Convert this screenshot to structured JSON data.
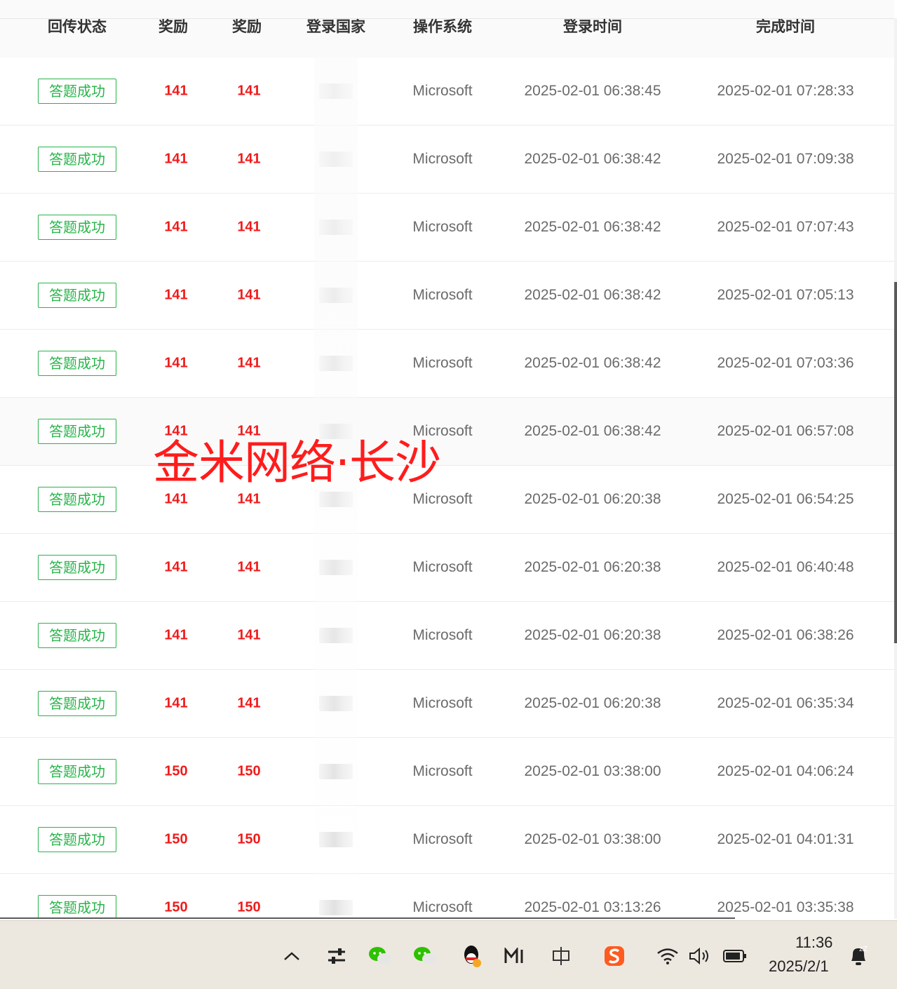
{
  "table": {
    "headers": [
      "回传状态",
      "奖励",
      "奖励",
      "登录国家",
      "操作系统",
      "登录时间",
      "完成时间"
    ],
    "rows": [
      {
        "status": "答题成功",
        "reward1": "141",
        "reward2": "141",
        "os": "Microsoft",
        "login": "2025-02-01 06:38:45",
        "done": "2025-02-01 07:28:33"
      },
      {
        "status": "答题成功",
        "reward1": "141",
        "reward2": "141",
        "os": "Microsoft",
        "login": "2025-02-01 06:38:42",
        "done": "2025-02-01 07:09:38"
      },
      {
        "status": "答题成功",
        "reward1": "141",
        "reward2": "141",
        "os": "Microsoft",
        "login": "2025-02-01 06:38:42",
        "done": "2025-02-01 07:07:43"
      },
      {
        "status": "答题成功",
        "reward1": "141",
        "reward2": "141",
        "os": "Microsoft",
        "login": "2025-02-01 06:38:42",
        "done": "2025-02-01 07:05:13"
      },
      {
        "status": "答题成功",
        "reward1": "141",
        "reward2": "141",
        "os": "Microsoft",
        "login": "2025-02-01 06:38:42",
        "done": "2025-02-01 07:03:36"
      },
      {
        "status": "答题成功",
        "reward1": "141",
        "reward2": "141",
        "os": "Microsoft",
        "login": "2025-02-01 06:38:42",
        "done": "2025-02-01 06:57:08"
      },
      {
        "status": "答题成功",
        "reward1": "141",
        "reward2": "141",
        "os": "Microsoft",
        "login": "2025-02-01 06:20:38",
        "done": "2025-02-01 06:54:25"
      },
      {
        "status": "答题成功",
        "reward1": "141",
        "reward2": "141",
        "os": "Microsoft",
        "login": "2025-02-01 06:20:38",
        "done": "2025-02-01 06:40:48"
      },
      {
        "status": "答题成功",
        "reward1": "141",
        "reward2": "141",
        "os": "Microsoft",
        "login": "2025-02-01 06:20:38",
        "done": "2025-02-01 06:38:26"
      },
      {
        "status": "答题成功",
        "reward1": "141",
        "reward2": "141",
        "os": "Microsoft",
        "login": "2025-02-01 06:20:38",
        "done": "2025-02-01 06:35:34"
      },
      {
        "status": "答题成功",
        "reward1": "150",
        "reward2": "150",
        "os": "Microsoft",
        "login": "2025-02-01 03:38:00",
        "done": "2025-02-01 04:06:24"
      },
      {
        "status": "答题成功",
        "reward1": "150",
        "reward2": "150",
        "os": "Microsoft",
        "login": "2025-02-01 03:38:00",
        "done": "2025-02-01 04:01:31"
      },
      {
        "status": "答题成功",
        "reward1": "150",
        "reward2": "150",
        "os": "Microsoft",
        "login": "2025-02-01 03:13:26",
        "done": "2025-02-01 03:35:38"
      }
    ]
  },
  "watermark": "金米网络·长沙",
  "taskbar": {
    "time": "11:36",
    "date": "2025/2/1",
    "icons": [
      "chevron-up-icon",
      "settings-sliders-icon",
      "wechat-icon",
      "wechat-work-icon",
      "qq-icon",
      "mail-m-icon",
      "ime-chinese-icon",
      "sogou-input-icon",
      "wifi-icon",
      "volume-icon",
      "battery-icon",
      "notification-sleep-icon"
    ]
  },
  "colors": {
    "status_green": "#28b44a",
    "reward_red": "#f01c1c",
    "watermark_red": "#ff1c1c",
    "taskbar_bg": "#ede8df"
  }
}
